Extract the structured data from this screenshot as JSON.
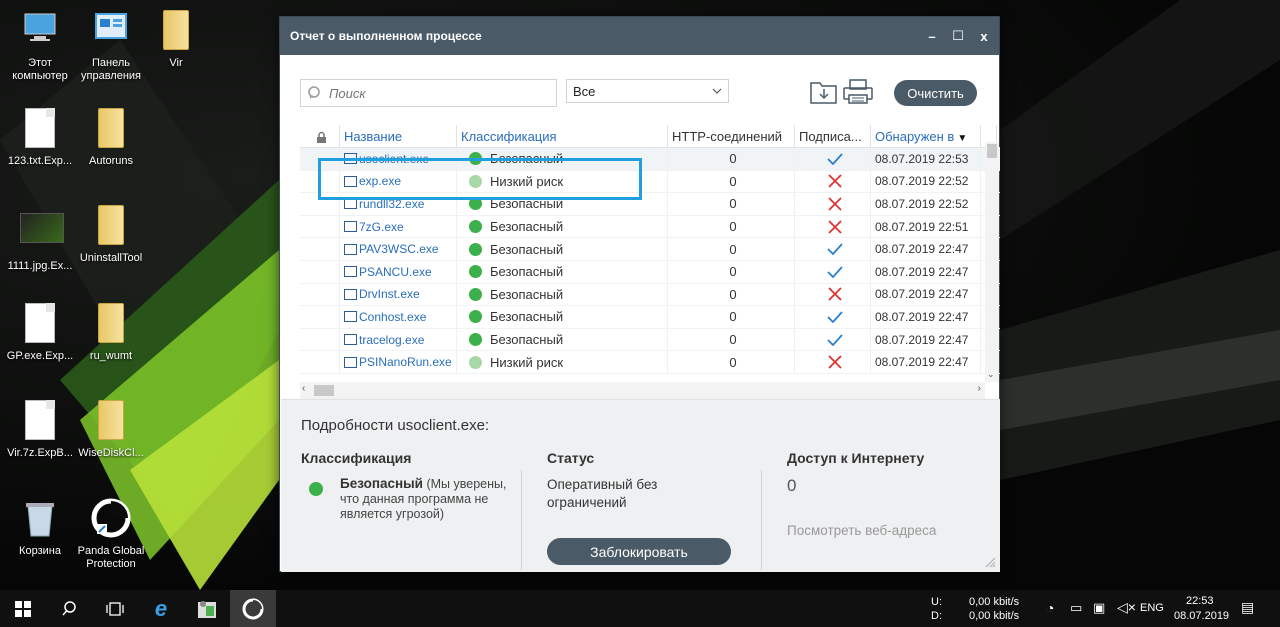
{
  "desktop": {
    "icons": [
      {
        "label": "Этот компьютер",
        "kind": "computer"
      },
      {
        "label": "Панель управления",
        "kind": "control-panel"
      },
      {
        "label": "Vir",
        "kind": "folder"
      },
      {
        "label": "123.txt.Exp...",
        "kind": "file"
      },
      {
        "label": "Autoruns",
        "kind": "folder"
      },
      {
        "label": "1111.jpg.Ex...",
        "kind": "image"
      },
      {
        "label": "UninstallTool",
        "kind": "folder"
      },
      {
        "label": "GP.exe.Exp...",
        "kind": "file"
      },
      {
        "label": "ru_wumt",
        "kind": "folder"
      },
      {
        "label": "Vir.7z.ExpB...",
        "kind": "file"
      },
      {
        "label": "WiseDiskCl...",
        "kind": "folder"
      },
      {
        "label": "Корзина",
        "kind": "recycle-bin"
      },
      {
        "label": "Panda Global Protection",
        "kind": "panda"
      }
    ]
  },
  "window": {
    "title": "Отчет о выполненном процессе",
    "controls": {
      "minimize": "–",
      "maximize": "☐",
      "close": "x"
    }
  },
  "toolbar": {
    "search_placeholder": "Поиск",
    "filter_value": "Все",
    "clear_label": "Очистить"
  },
  "table": {
    "columns": [
      "Название",
      "Классификация",
      "HTTP-соединений",
      "Подписа...",
      "Обнаружен в"
    ],
    "rows": [
      {
        "name": "usoclient.exe",
        "classification": "Безопасный",
        "level": "safe",
        "http": "0",
        "signed": true,
        "date": "08.07.2019 22:53"
      },
      {
        "name": "exp.exe",
        "classification": "Низкий риск",
        "level": "low",
        "http": "0",
        "signed": false,
        "date": "08.07.2019 22:52"
      },
      {
        "name": "rundll32.exe",
        "classification": "Безопасный",
        "level": "safe",
        "http": "0",
        "signed": false,
        "date": "08.07.2019 22:52"
      },
      {
        "name": "7zG.exe",
        "classification": "Безопасный",
        "level": "safe",
        "http": "0",
        "signed": false,
        "date": "08.07.2019 22:51"
      },
      {
        "name": "PAV3WSC.exe",
        "classification": "Безопасный",
        "level": "safe",
        "http": "0",
        "signed": true,
        "date": "08.07.2019 22:47"
      },
      {
        "name": "PSANCU.exe",
        "classification": "Безопасный",
        "level": "safe",
        "http": "0",
        "signed": true,
        "date": "08.07.2019 22:47"
      },
      {
        "name": "DrvInst.exe",
        "classification": "Безопасный",
        "level": "safe",
        "http": "0",
        "signed": false,
        "date": "08.07.2019 22:47"
      },
      {
        "name": "Conhost.exe",
        "classification": "Безопасный",
        "level": "safe",
        "http": "0",
        "signed": true,
        "date": "08.07.2019 22:47"
      },
      {
        "name": "tracelog.exe",
        "classification": "Безопасный",
        "level": "safe",
        "http": "0",
        "signed": true,
        "date": "08.07.2019 22:47"
      },
      {
        "name": "PSINanoRun.exe",
        "classification": "Низкий риск",
        "level": "low",
        "http": "0",
        "signed": false,
        "date": "08.07.2019 22:47"
      }
    ]
  },
  "details": {
    "title_prefix": "Подробности",
    "selected_name": "usoclient.exe:",
    "classification": {
      "heading": "Классификация",
      "value": "Безопасный",
      "description": "(Мы уверены, что данная программа не является угрозой)"
    },
    "status": {
      "heading": "Статус",
      "value": "Оперативный без ограничений",
      "block_label": "Заблокировать"
    },
    "internet": {
      "heading": "Доступ к Интернету",
      "value": "0",
      "link": "Посмотреть веб-адреса"
    }
  },
  "taskbar": {
    "net_up_label": "U:",
    "net_down_label": "D:",
    "net_up": "0,00 kbit/s",
    "net_down": "0,00 kbit/s",
    "lang": "ENG",
    "time": "22:53",
    "date": "08.07.2019"
  },
  "colors": {
    "safe": "#3cb04a",
    "low": "#a8d8a8",
    "accent": "#4a5a66",
    "link": "#2a6ebb",
    "highlight": "#1ea0df"
  }
}
